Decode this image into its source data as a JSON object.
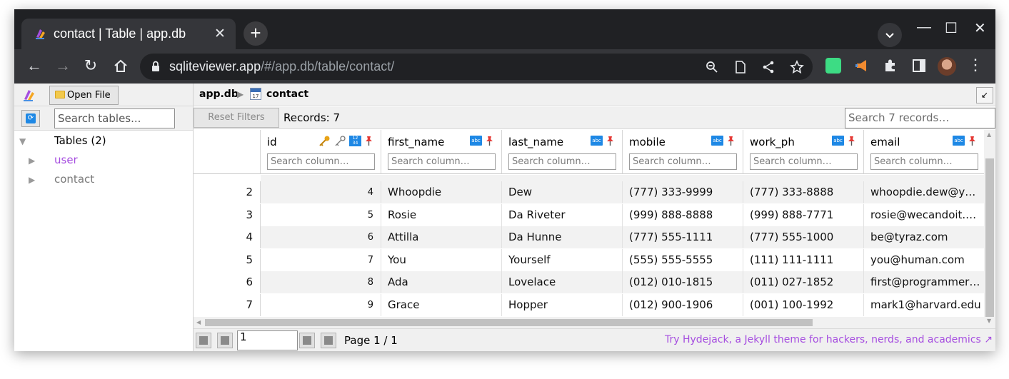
{
  "browser": {
    "tab_title": "contact | Table | app.db",
    "tab_close": "✕",
    "new_tab": "+",
    "url_host": "sqliteviewer.app",
    "url_path": "/#/app.db/table/contact/",
    "minimize": "—",
    "maximize": "☐",
    "close": "✕"
  },
  "sidebar": {
    "open_file_label": "Open File",
    "search_placeholder": "Search tables...",
    "tree_root": "Tables (2)",
    "tables": [
      {
        "name": "user",
        "color": "#a64ee0"
      },
      {
        "name": "contact",
        "color": "#7a7a7a"
      }
    ]
  },
  "breadcrumb": {
    "db": "app.db",
    "separator": "▶",
    "table": "contact",
    "calendar_text": "17"
  },
  "filterbar": {
    "reset_label": "Reset Filters",
    "records_label": "Records: 7",
    "search_placeholder": "Search 7 records…"
  },
  "grid": {
    "column_search_placeholder": "Search column…",
    "columns": [
      {
        "name": "id",
        "type": "integer-key"
      },
      {
        "name": "first_name",
        "type": "text"
      },
      {
        "name": "last_name",
        "type": "text"
      },
      {
        "name": "mobile",
        "type": "text"
      },
      {
        "name": "work_ph",
        "type": "text"
      },
      {
        "name": "email",
        "type": "text"
      }
    ],
    "rows": [
      {
        "rownum": "2",
        "id": "4",
        "first_name": "Whoopdie",
        "last_name": "Dew",
        "mobile": "(777) 333-9999",
        "work_ph": "(777) 333-8888",
        "email": "whoopdie.dew@y…"
      },
      {
        "rownum": "3",
        "id": "5",
        "first_name": "Rosie",
        "last_name": "Da Riveter",
        "mobile": "(999) 888-8888",
        "work_ph": "(999) 888-7771",
        "email": "rosie@wecandoit.…"
      },
      {
        "rownum": "4",
        "id": "6",
        "first_name": "Attilla",
        "last_name": "Da Hunne",
        "mobile": "(777) 555-1111",
        "work_ph": "(777) 555-1000",
        "email": "be@tyraz.com"
      },
      {
        "rownum": "5",
        "id": "7",
        "first_name": "You",
        "last_name": "Yourself",
        "mobile": "(555) 555-5555",
        "work_ph": "(111) 111-1111",
        "email": "you@human.com"
      },
      {
        "rownum": "6",
        "id": "8",
        "first_name": "Ada",
        "last_name": "Lovelace",
        "mobile": "(012) 010-1815",
        "work_ph": "(011) 027-1852",
        "email": "first@programmer…"
      },
      {
        "rownum": "7",
        "id": "9",
        "first_name": "Grace",
        "last_name": "Hopper",
        "mobile": "(012) 900-1906",
        "work_ph": "(001) 100-1992",
        "email": "mark1@harvard.edu"
      }
    ]
  },
  "pager": {
    "page_input_value": "1",
    "page_text": "Page 1 / 1",
    "promo": "Try Hydejack, a Jekyll theme for hackers, nerds, and academics ↗"
  },
  "colors": {
    "accent_purple": "#a64ee0",
    "type_badge_blue": "#1e88e5",
    "browser_dark": "#202124"
  }
}
